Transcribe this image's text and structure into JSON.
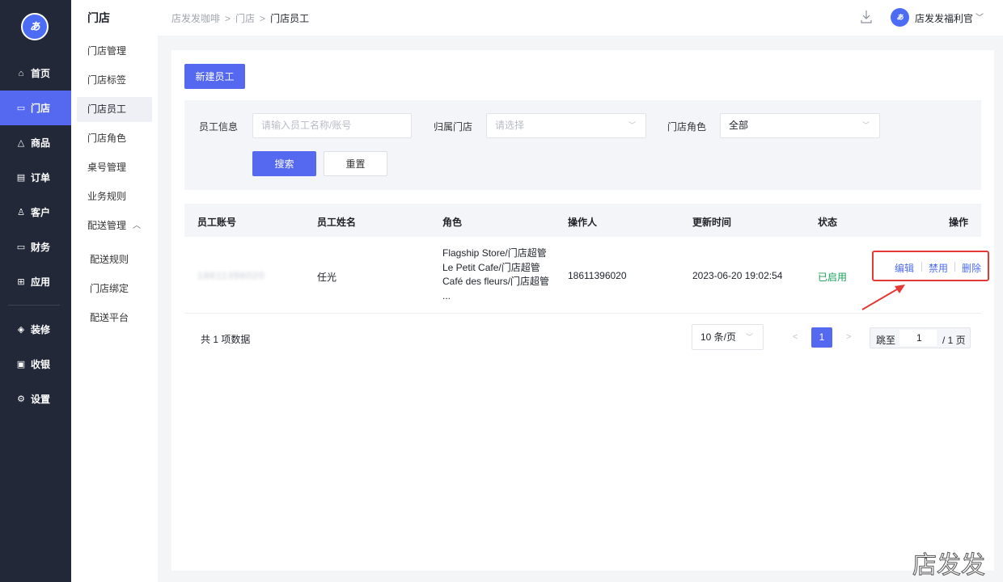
{
  "nav": {
    "items": [
      {
        "label": "首页",
        "icon": "home-icon"
      },
      {
        "label": "门店",
        "icon": "store-icon"
      },
      {
        "label": "商品",
        "icon": "bag-icon"
      },
      {
        "label": "订单",
        "icon": "order-icon"
      },
      {
        "label": "客户",
        "icon": "customer-icon"
      },
      {
        "label": "财务",
        "icon": "wallet-icon"
      },
      {
        "label": "应用",
        "icon": "apps-icon"
      },
      {
        "label": "装修",
        "icon": "layers-icon"
      },
      {
        "label": "收银",
        "icon": "cashier-icon"
      },
      {
        "label": "设置",
        "icon": "settings-icon"
      }
    ],
    "active": "门店"
  },
  "subnav": {
    "title": "门店",
    "items": [
      {
        "label": "门店管理"
      },
      {
        "label": "门店标签"
      },
      {
        "label": "门店员工"
      },
      {
        "label": "门店角色"
      },
      {
        "label": "桌号管理"
      },
      {
        "label": "业务规则"
      },
      {
        "label": "配送管理"
      },
      {
        "label": "配送规则"
      },
      {
        "label": "门店绑定"
      },
      {
        "label": "配送平台"
      }
    ],
    "active": "门店员工"
  },
  "header": {
    "breadcrumbs": [
      "店发发咖啡",
      "门店",
      "门店员工"
    ],
    "user_name": "店发发福利官",
    "download_icon": "download-icon"
  },
  "toolbar": {
    "new_label": "新建员工"
  },
  "filters": {
    "employee_label": "员工信息",
    "employee_placeholder": "请输入员工名称/账号",
    "store_label": "归属门店",
    "store_placeholder": "请选择",
    "role_label": "门店角色",
    "role_value": "全部",
    "search_label": "搜索",
    "reset_label": "重置"
  },
  "table": {
    "columns": [
      "员工账号",
      "员工姓名",
      "角色",
      "操作人",
      "更新时间",
      "状态",
      "操作"
    ],
    "rows": [
      {
        "account": "18611396020",
        "name": "任光",
        "roles": [
          "Flagship Store/门店超管",
          "Le Petit Cafe/门店超管",
          "Café des fleurs/门店超管",
          "..."
        ],
        "operator": "18611396020",
        "updated": "2023-06-20 19:02:54",
        "status": "已启用",
        "actions": [
          "编辑",
          "禁用",
          "删除"
        ]
      }
    ]
  },
  "pagination": {
    "total_text": "共 1 项数据",
    "page_size": "10 条/页",
    "current_page": "1",
    "jump_label": "跳至",
    "jump_value": "1",
    "total_pages_text": "/ 1 页"
  },
  "watermark": "店发发",
  "colors": {
    "accent": "#5468f0",
    "nav_bg": "#222838",
    "status_green": "#18a058",
    "highlight_red": "#e53935"
  }
}
